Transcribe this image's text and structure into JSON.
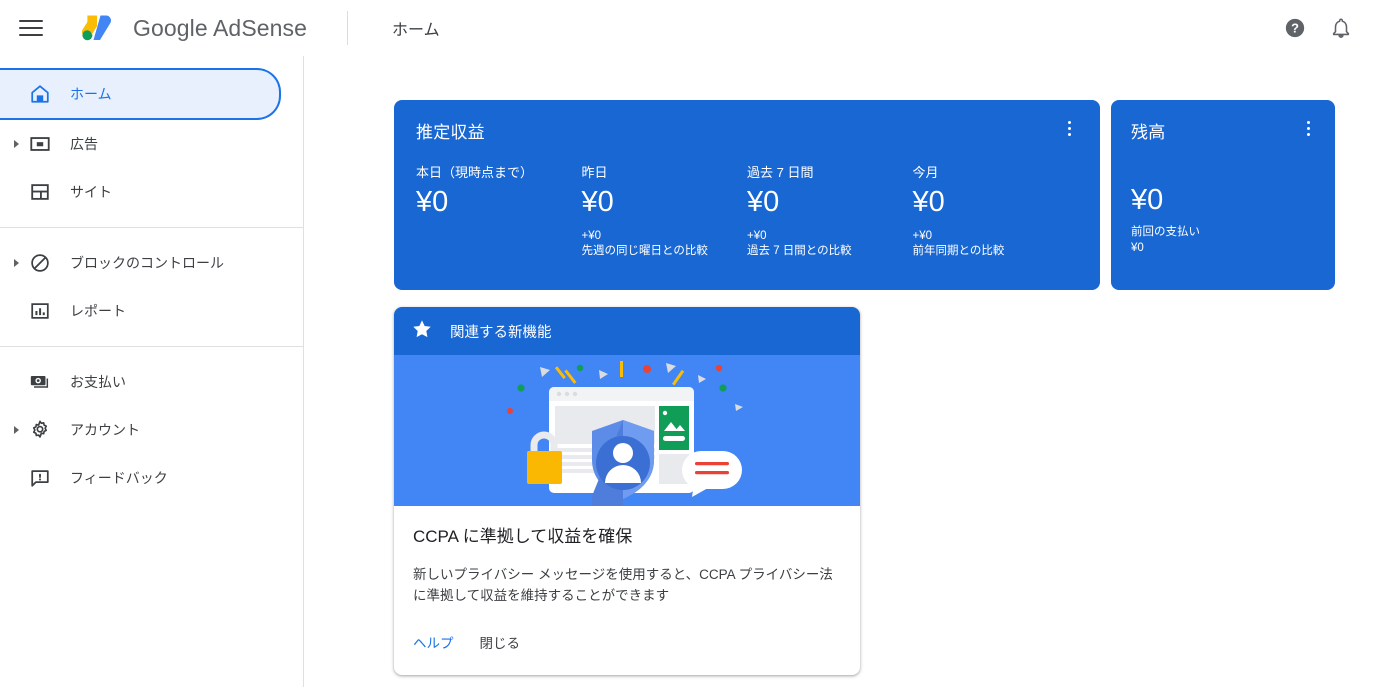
{
  "appbar": {
    "menu_label": "menu",
    "brand": "Google AdSense",
    "page_title": "ホーム",
    "help_label": "ヘルプ",
    "notifications_label": "通知"
  },
  "sidebar": {
    "items": [
      {
        "label": "ホーム",
        "icon": "home-icon",
        "active": true,
        "expandable": false
      },
      {
        "label": "広告",
        "icon": "ads-icon",
        "active": false,
        "expandable": true
      },
      {
        "label": "サイト",
        "icon": "sites-icon",
        "active": false,
        "expandable": false
      },
      {
        "label": "ブロックのコントロール",
        "icon": "block-icon",
        "active": false,
        "expandable": true
      },
      {
        "label": "レポート",
        "icon": "reports-icon",
        "active": false,
        "expandable": false
      },
      {
        "label": "お支払い",
        "icon": "payments-icon",
        "active": false,
        "expandable": false
      },
      {
        "label": "アカウント",
        "icon": "gear-icon",
        "active": false,
        "expandable": true
      },
      {
        "label": "フィードバック",
        "icon": "feedback-icon",
        "active": false,
        "expandable": false
      }
    ]
  },
  "earnings_card": {
    "title": "推定収益",
    "metrics": [
      {
        "label": "本日（現時点まで）",
        "value": "¥0",
        "delta": "",
        "comparison": ""
      },
      {
        "label": "昨日",
        "value": "¥0",
        "delta": "+¥0",
        "comparison": "先週の同じ曜日との比較"
      },
      {
        "label": "過去 7 日間",
        "value": "¥0",
        "delta": "+¥0",
        "comparison": "過去 7 日間との比較"
      },
      {
        "label": "今月",
        "value": "¥0",
        "delta": "+¥0",
        "comparison": "前年同期との比較"
      }
    ]
  },
  "balance_card": {
    "title": "残高",
    "value": "¥0",
    "sub_label": "前回の支払い",
    "sub_amount": "¥0"
  },
  "news_card": {
    "header": "関連する新機能",
    "title": "CCPA に準拠して収益を確保",
    "body": "新しいプライバシー メッセージを使用すると、CCPA プライバシー法に準拠して収益を維持することができます",
    "help_label": "ヘルプ",
    "dismiss_label": "閉じる"
  },
  "colors": {
    "card_blue": "#1967d2",
    "hero_blue": "#4285f4",
    "accent": "#1a73e8",
    "active_bg": "#e8f0fe",
    "text_primary": "#3c4043",
    "text_muted": "#5f6368"
  }
}
